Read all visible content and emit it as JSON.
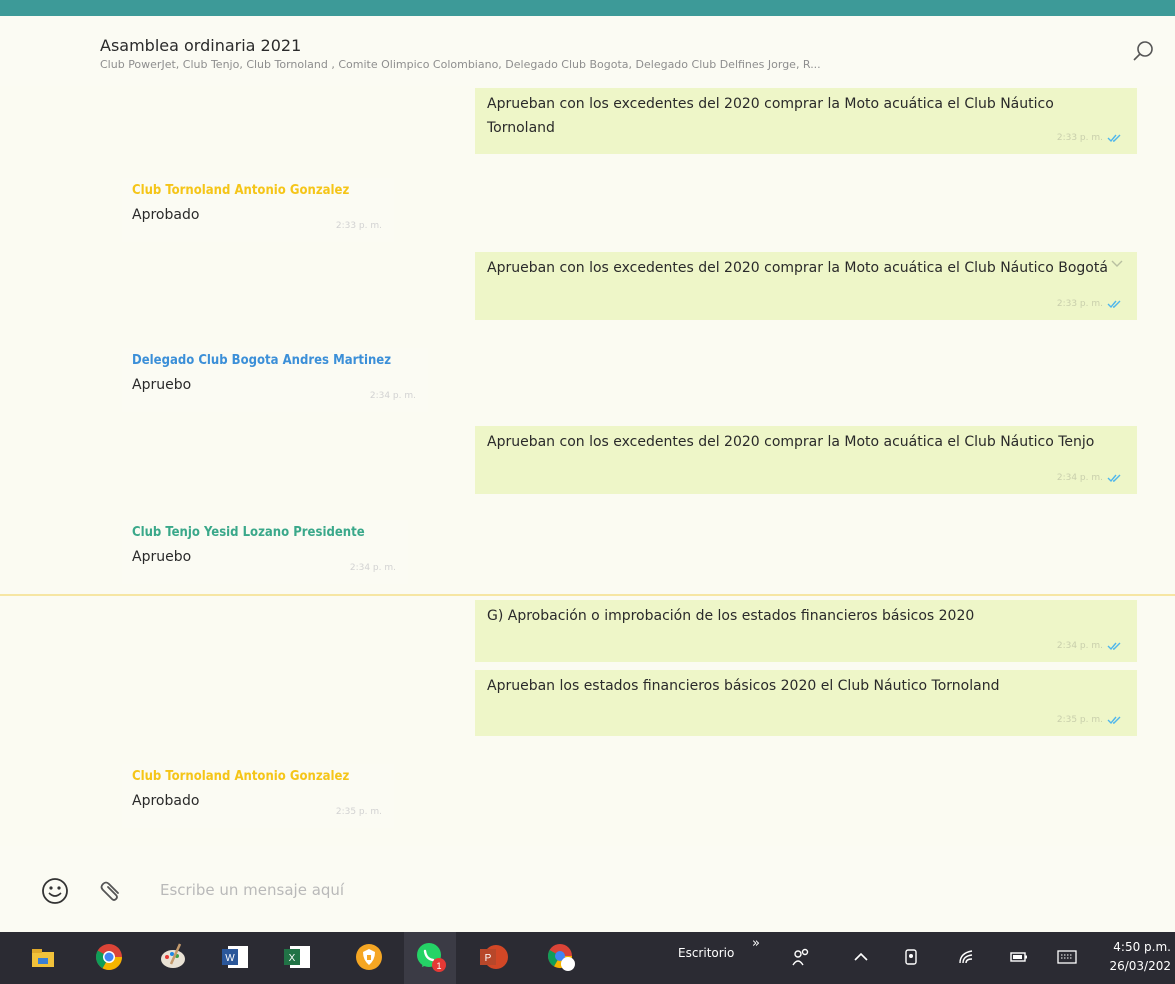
{
  "header": {
    "title": "Asamblea ordinaria 2021",
    "subtitle": "Club PowerJet, Club Tenjo, Club Tornoland , Comite Olimpico Colombiano, Delegado Club Bogota, Delegado Club Delfines Jorge, R..."
  },
  "messages": [
    {
      "type": "out",
      "text": "Aprueban con los excedentes del 2020 comprar la Moto acuática el Club Náutico Tornoland",
      "time": "2:33 p. m."
    },
    {
      "type": "in",
      "sender": "Club Tornoland Antonio Gonzalez",
      "sender_color": "#f5c518",
      "text": "Aprobado",
      "time": "2:33 p. m."
    },
    {
      "type": "out",
      "text": "Aprueban con los excedentes del 2020 comprar la Moto acuática el Club Náutico Bogotá",
      "time": "2:33 p. m."
    },
    {
      "type": "in",
      "sender": "Delegado Club Bogota Andres Martinez",
      "sender_color": "#3b8fd8",
      "text": "Apruebo",
      "time": "2:34 p. m."
    },
    {
      "type": "out",
      "text": "Aprueban con los excedentes del 2020 comprar la Moto acuática el Club Náutico Tenjo",
      "time": "2:34 p. m."
    },
    {
      "type": "in",
      "sender": "Club Tenjo Yesid Lozano Presidente",
      "sender_color": "#3aa88a",
      "text": "Apruebo",
      "time": "2:34 p. m."
    },
    {
      "type": "out",
      "text": "G)    Aprobación o improbación de los estados financieros básicos 2020",
      "time": "2:34 p. m."
    },
    {
      "type": "out",
      "text": "Aprueban los estados financieros básicos 2020 el Club Náutico Tornoland",
      "time": "2:35 p. m."
    },
    {
      "type": "in",
      "sender": "Club Tornoland Antonio Gonzalez",
      "sender_color": "#f5c518",
      "text": "Aprobado",
      "time": "2:35 p. m."
    }
  ],
  "composer": {
    "placeholder": "Escribe un mensaje aquí"
  },
  "taskbar": {
    "desktop_label": "Escritorio",
    "chevron": "»",
    "time": "4:50 p.m.",
    "date": "26/03/202",
    "whatsapp_badge": "1",
    "apps": [
      "file-explorer",
      "chrome",
      "paint",
      "word",
      "excel",
      "vpn",
      "whatsapp",
      "powerpoint",
      "chrome-alt"
    ]
  },
  "colors": {
    "out_bubble": "#eef6c8",
    "tick_blue": "#4fb6ec",
    "taskbar": "#2b2b33"
  }
}
